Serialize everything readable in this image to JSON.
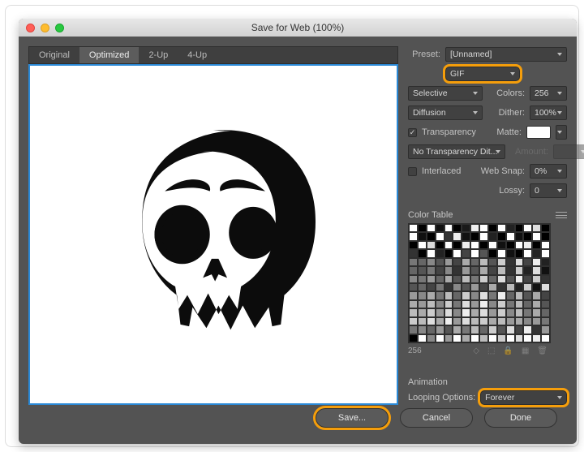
{
  "window": {
    "title": "Save for Web (100%)"
  },
  "tabs": [
    {
      "id": "original",
      "label": "Original",
      "active": false
    },
    {
      "id": "optimized",
      "label": "Optimized",
      "active": true
    },
    {
      "id": "2up",
      "label": "2-Up",
      "active": false
    },
    {
      "id": "4up",
      "label": "4-Up",
      "active": false
    }
  ],
  "preset": {
    "label": "Preset:",
    "value": "[Unnamed]"
  },
  "format": {
    "value": "GIF"
  },
  "reduction": {
    "value": "Selective"
  },
  "colors": {
    "label": "Colors:",
    "value": "256"
  },
  "dither_method": {
    "value": "Diffusion"
  },
  "dither": {
    "label": "Dither:",
    "value": "100%"
  },
  "transparency": {
    "label": "Transparency",
    "checked": true
  },
  "matte": {
    "label": "Matte:",
    "value": "#ffffff"
  },
  "trans_dither": {
    "value": "No Transparency Dit..."
  },
  "amount": {
    "label": "Amount:",
    "value": ""
  },
  "interlaced": {
    "label": "Interlaced",
    "checked": false
  },
  "websnap": {
    "label": "Web Snap:",
    "value": "0%"
  },
  "lossy": {
    "label": "Lossy:",
    "value": "0"
  },
  "color_table": {
    "label": "Color Table",
    "count": "256"
  },
  "animation": {
    "label": "Animation",
    "looping_label": "Looping Options:",
    "looping_value": "Forever"
  },
  "buttons": {
    "save": "Save...",
    "cancel": "Cancel",
    "done": "Done"
  },
  "highlights": {
    "format": true,
    "looping": true,
    "save": true
  },
  "grayscale_swatches": [
    "#fff",
    "#000",
    "#fff",
    "#111",
    "#fff",
    "#000",
    "#1a1a1a",
    "#eee",
    "#fff",
    "#000",
    "#fff",
    "#222",
    "#000",
    "#fff",
    "#ddd",
    "#000",
    "#fff",
    "#111",
    "#000",
    "#fff",
    "#333",
    "#eee",
    "#111",
    "#000",
    "#fff",
    "#222",
    "#000",
    "#fff",
    "#111",
    "#000",
    "#fff",
    "#000",
    "#000",
    "#fff",
    "#ddd",
    "#000",
    "#fff",
    "#000",
    "#eee",
    "#fff",
    "#000",
    "#fff",
    "#111",
    "#000",
    "#fff",
    "#eee",
    "#000",
    "#fff",
    "#333",
    "#000",
    "#fff",
    "#222",
    "#000",
    "#fff",
    "#444",
    "#fff",
    "#555",
    "#000",
    "#fff",
    "#111",
    "#000",
    "#fff",
    "#222",
    "#fff",
    "#777",
    "#666",
    "#888",
    "#555",
    "#999",
    "#444",
    "#aaa",
    "#666",
    "#bbb",
    "#555",
    "#ccc",
    "#333",
    "#ddd",
    "#444",
    "#eee",
    "#222",
    "#666",
    "#555",
    "#777",
    "#444",
    "#888",
    "#333",
    "#999",
    "#555",
    "#aaa",
    "#444",
    "#bbb",
    "#333",
    "#ccc",
    "#222",
    "#ddd",
    "#111",
    "#888",
    "#777",
    "#999",
    "#666",
    "#aaa",
    "#555",
    "#bbb",
    "#777",
    "#ccc",
    "#666",
    "#ddd",
    "#555",
    "#eee",
    "#444",
    "#ccc",
    "#333",
    "#555",
    "#666",
    "#444",
    "#777",
    "#333",
    "#888",
    "#555",
    "#999",
    "#444",
    "#aaa",
    "#333",
    "#bbb",
    "#222",
    "#ccc",
    "#111",
    "#ddd",
    "#999",
    "#888",
    "#aaa",
    "#777",
    "#bbb",
    "#666",
    "#ccc",
    "#888",
    "#ddd",
    "#777",
    "#eee",
    "#666",
    "#bbb",
    "#555",
    "#aaa",
    "#444",
    "#aaa",
    "#999",
    "#bbb",
    "#888",
    "#ccc",
    "#777",
    "#ddd",
    "#999",
    "#eee",
    "#888",
    "#ccc",
    "#777",
    "#bbb",
    "#666",
    "#aaa",
    "#555",
    "#bbb",
    "#aaa",
    "#ccc",
    "#999",
    "#ddd",
    "#888",
    "#eee",
    "#aaa",
    "#ddd",
    "#999",
    "#ccc",
    "#888",
    "#bbb",
    "#777",
    "#aaa",
    "#666",
    "#ccc",
    "#bbb",
    "#ddd",
    "#aaa",
    "#eee",
    "#999",
    "#ddd",
    "#bbb",
    "#ccc",
    "#aaa",
    "#bbb",
    "#999",
    "#aaa",
    "#888",
    "#999",
    "#777",
    "#777",
    "#888",
    "#666",
    "#999",
    "#555",
    "#aaa",
    "#777",
    "#bbb",
    "#666",
    "#ccc",
    "#555",
    "#ddd",
    "#444",
    "#eee",
    "#333",
    "#999",
    "#000",
    "#fff",
    "#888",
    "#fff",
    "#999",
    "#fff",
    "#aaa",
    "#fff",
    "#bbb",
    "#fff",
    "#ccc",
    "#fff",
    "#ddd",
    "#fff",
    "#eee",
    "#fff"
  ]
}
